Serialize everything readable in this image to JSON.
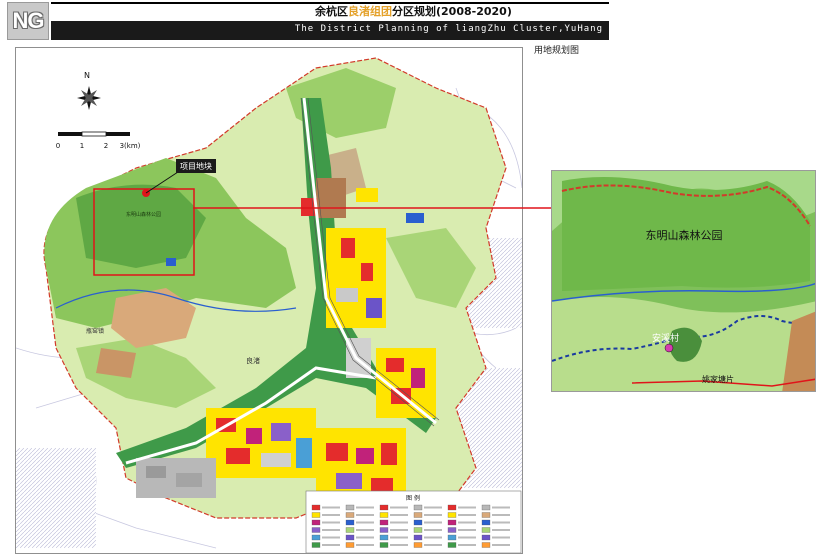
{
  "header": {
    "logo": "NG",
    "title_prefix": "余杭区",
    "title_highlight": "良渚组团",
    "title_suffix": "分区规划(2008-2020)",
    "subtitle_en": "The District Planning of liangZhu Cluster,YuHang"
  },
  "sublabel": "用地规划图",
  "map": {
    "north_label": "N",
    "scale_labels": [
      "0",
      "1",
      "2",
      "3(km)"
    ],
    "callout_label": "项目地块",
    "place_labels": {
      "forest_park_small": "东明山森林公园",
      "liangzhu_town": "良渚",
      "pingyao": "瓶窑镇"
    },
    "legend_title": "图  例"
  },
  "inset": {
    "park_name": "东明山森林公园",
    "village": "安溪村",
    "yao_label": "姚家塘片"
  },
  "colors": {
    "forest_green": "#6fb84a",
    "light_green": "#c9e59a",
    "residential_yellow": "#ffe400",
    "commercial_red": "#e42c2c",
    "road_green": "#2e8b3c",
    "water_blue": "#2a5fcf",
    "boundary_red": "#d23a2a"
  }
}
